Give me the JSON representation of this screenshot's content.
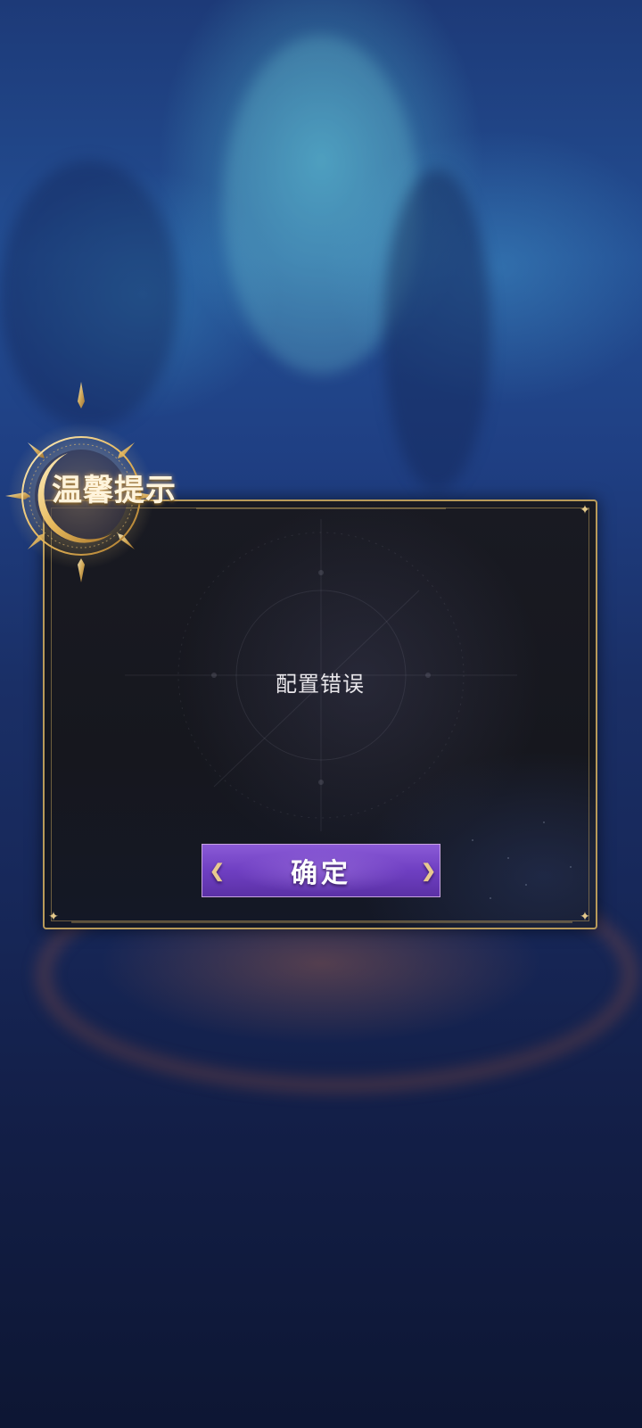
{
  "dialog": {
    "title": "温馨提示",
    "message": "配置错误",
    "confirm_label": "确定"
  },
  "icons": {
    "emblem": "crescent-moon-sun-icon",
    "corner": "corner-sparkle-icon",
    "button_ornament": "gold-filigree-icon"
  },
  "colors": {
    "gold": "#b89a5a",
    "dialog_bg": "#16171e",
    "button_purple": "#7a4acb",
    "message_text": "#e8e6ea"
  }
}
